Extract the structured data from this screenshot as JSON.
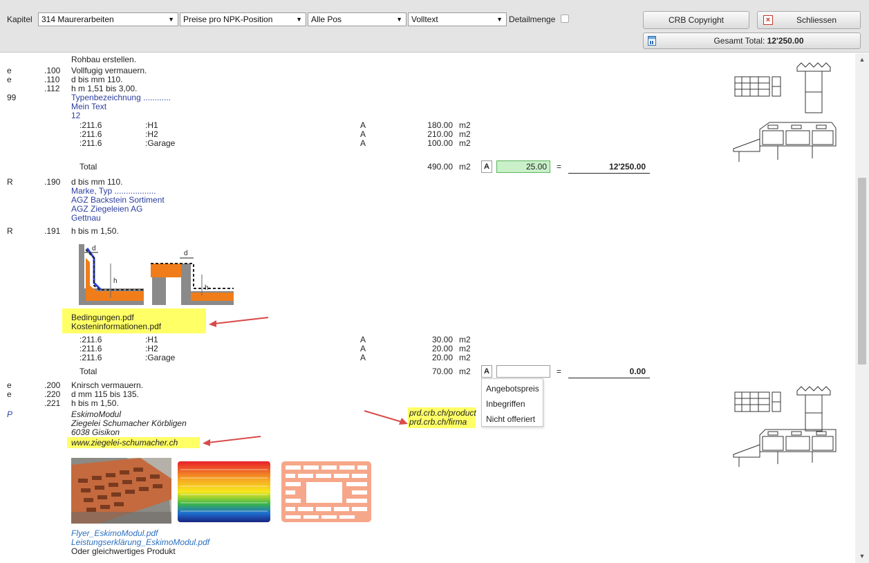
{
  "toolbar": {
    "kapitel_label": "Kapitel",
    "kapitel_select": "314 Maurerarbeiten",
    "price_mode_select": "Preise pro NPK-Position",
    "position_filter_select": "Alle Pos",
    "text_mode_select": "Volltext",
    "detailmenge_label": "Detailmenge",
    "copyright_button": "CRB Copyright",
    "close_button": "Schliessen",
    "total_label": "Gesamt Total:",
    "total_value": "12'250.00"
  },
  "content": {
    "top_line": "Rohbau erstellen.",
    "p100": {
      "code": "e",
      "number": ".100",
      "text": "Vollfugig vermauern."
    },
    "p110": {
      "code": "e",
      "number": ".110",
      "text": "d bis mm 110."
    },
    "p112": {
      "number": ".112",
      "text": "h m 1,51 bis 3,00.",
      "code99": "99",
      "type_label": "Typenbezeichnung ............",
      "my_text": "Mein Text",
      "twelve": "12",
      "rows": [
        {
          "code": ":211.6",
          "label": ":H1",
          "a": "A",
          "qty": "180.00",
          "unit": "m2"
        },
        {
          "code": ":211.6",
          "label": ":H2",
          "a": "A",
          "qty": "210.00",
          "unit": "m2"
        },
        {
          "code": ":211.6",
          "label": ":Garage",
          "a": "A",
          "qty": "100.00",
          "unit": "m2"
        }
      ],
      "total_label": "Total",
      "total_qty": "490.00",
      "total_unit": "m2",
      "a_badge": "A",
      "unit_price": "25.00",
      "eq": "=",
      "line_total": "12'250.00"
    },
    "p190": {
      "code": "R",
      "number": ".190",
      "text": "d bis mm 110.",
      "brand_label": "Marke, Typ ..................",
      "l1": "AGZ Backstein Sortiment",
      "l2": "AGZ Ziegeleien AG",
      "l3": "Gettnau"
    },
    "p191": {
      "code": "R",
      "number": ".191",
      "text": "h bis m 1,50.",
      "pdf1": "Bedingungen.pdf",
      "pdf2": "Kosteninformationen.pdf",
      "rows": [
        {
          "code": ":211.6",
          "label": ":H1",
          "a": "A",
          "qty": "30.00",
          "unit": "m2"
        },
        {
          "code": ":211.6",
          "label": ":H2",
          "a": "A",
          "qty": "20.00",
          "unit": "m2"
        },
        {
          "code": ":211.6",
          "label": ":Garage",
          "a": "A",
          "qty": "20.00",
          "unit": "m2"
        }
      ],
      "total_label": "Total",
      "total_qty": "70.00",
      "total_unit": "m2",
      "a_badge": "A",
      "eq": "=",
      "line_total": "0.00",
      "dropdown": [
        "Angebotspreis",
        "Inbegriffen",
        "Nicht offeriert"
      ]
    },
    "p200": {
      "code": "e",
      "number": ".200",
      "text": "Knirsch vermauern."
    },
    "p220": {
      "code": "e",
      "number": ".220",
      "text": "d mm 115 bis 135."
    },
    "p221": {
      "number": ".221",
      "text": "h bis m 1,50.",
      "code_p": "P",
      "product": "EskimoModul",
      "maker": "Ziegelei Schumacher Körbligen",
      "city": "6038 Gisikon",
      "website": "www.ziegelei-schumacher.ch",
      "link_product": "prd.crb.ch/product",
      "link_firma": "prd.crb.ch/firma",
      "flyer": "Flyer_EskimoModul.pdf",
      "declaration": "Leistungserklärung_EskimoModul.pdf",
      "equivalent": "Oder gleichwertiges Produkt"
    }
  },
  "colors": {
    "highlight": "#ffff66",
    "arrow": "#d94b4b",
    "price_active": "#c9f0c9",
    "blue_text": "#2c3e9e"
  }
}
